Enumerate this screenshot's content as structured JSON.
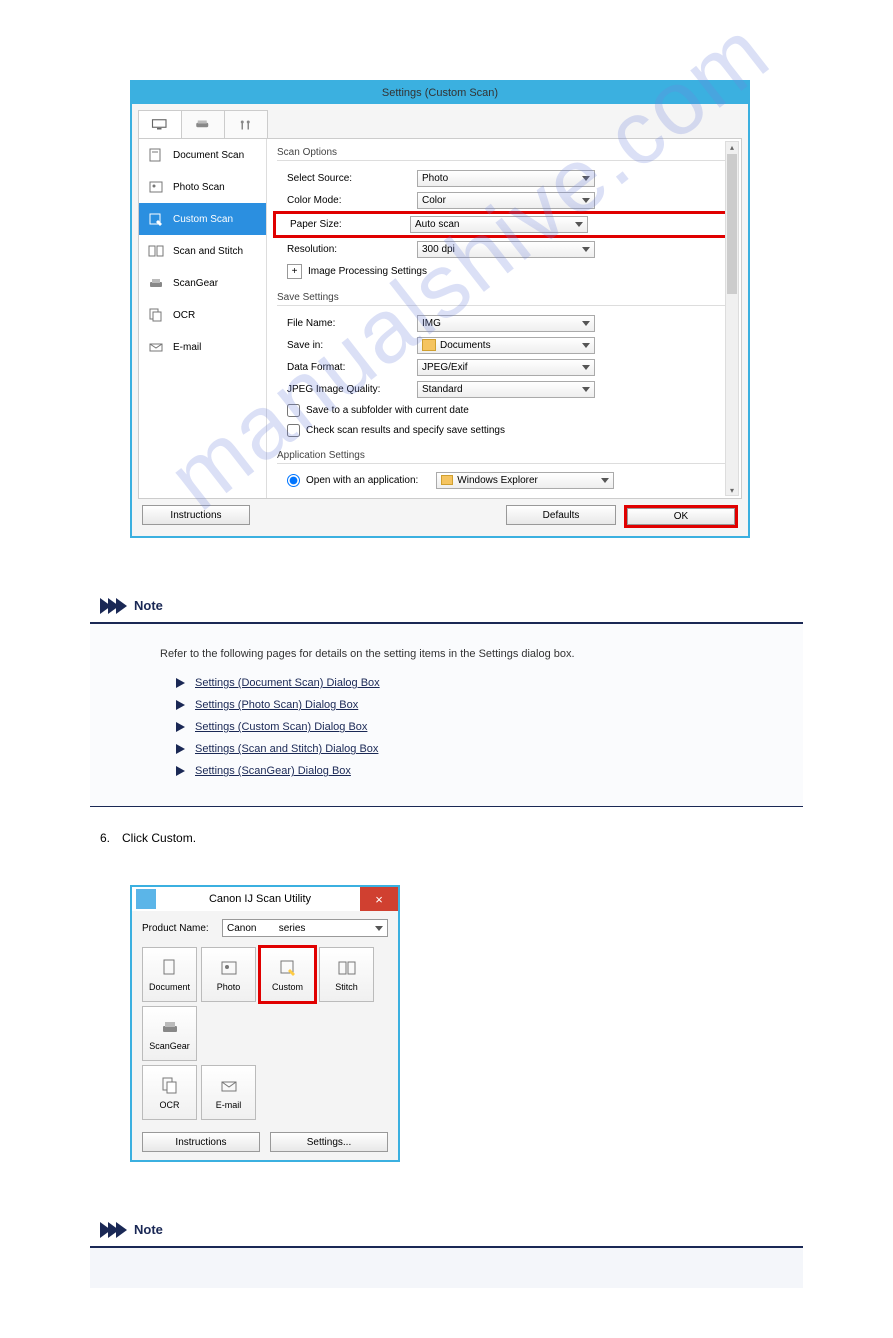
{
  "watermark": "manualshive.com",
  "settings_dialog": {
    "title": "Settings (Custom Scan)",
    "sidebar": [
      {
        "label": "Document Scan"
      },
      {
        "label": "Photo Scan"
      },
      {
        "label": "Custom Scan"
      },
      {
        "label": "Scan and Stitch"
      },
      {
        "label": "ScanGear"
      },
      {
        "label": "OCR"
      },
      {
        "label": "E-mail"
      }
    ],
    "scan_options": {
      "legend": "Scan Options",
      "select_source": {
        "label": "Select Source:",
        "value": "Photo"
      },
      "color_mode": {
        "label": "Color Mode:",
        "value": "Color"
      },
      "paper_size": {
        "label": "Paper Size:",
        "value": "Auto scan"
      },
      "resolution": {
        "label": "Resolution:",
        "value": "300 dpi"
      },
      "image_processing": "Image Processing Settings"
    },
    "save_settings": {
      "legend": "Save Settings",
      "file_name": {
        "label": "File Name:",
        "value": "IMG"
      },
      "save_in": {
        "label": "Save in:",
        "value": "Documents"
      },
      "data_format": {
        "label": "Data Format:",
        "value": "JPEG/Exif"
      },
      "jpeg_quality": {
        "label": "JPEG Image Quality:",
        "value": "Standard"
      },
      "save_subfolder": "Save to a subfolder with current date",
      "check_results": "Check scan results and specify save settings"
    },
    "app_settings": {
      "legend": "Application Settings",
      "open_with": {
        "label": "Open with an application:",
        "value": "Windows Explorer"
      }
    },
    "buttons": {
      "instructions": "Instructions",
      "defaults": "Defaults",
      "ok": "OK"
    }
  },
  "note1": {
    "heading": "Note",
    "intro": "Refer to the following pages for details on the setting items in the Settings dialog box.",
    "refs": [
      "Settings (Document Scan) Dialog Box",
      "Settings (Photo Scan) Dialog Box",
      "Settings (Custom Scan) Dialog Box",
      "Settings (Scan and Stitch) Dialog Box",
      "Settings (ScanGear) Dialog Box"
    ]
  },
  "step6": "Click Custom.",
  "utility": {
    "title": "Canon IJ Scan Utility",
    "product_label": "Product Name:",
    "product_value_prefix": "Canon",
    "product_value_suffix": "series",
    "tiles": [
      "Document",
      "Photo",
      "Custom",
      "Stitch",
      "ScanGear",
      "OCR",
      "E-mail"
    ],
    "buttons": {
      "instructions": "Instructions",
      "settings": "Settings..."
    }
  },
  "note2": {
    "heading": "Note"
  }
}
